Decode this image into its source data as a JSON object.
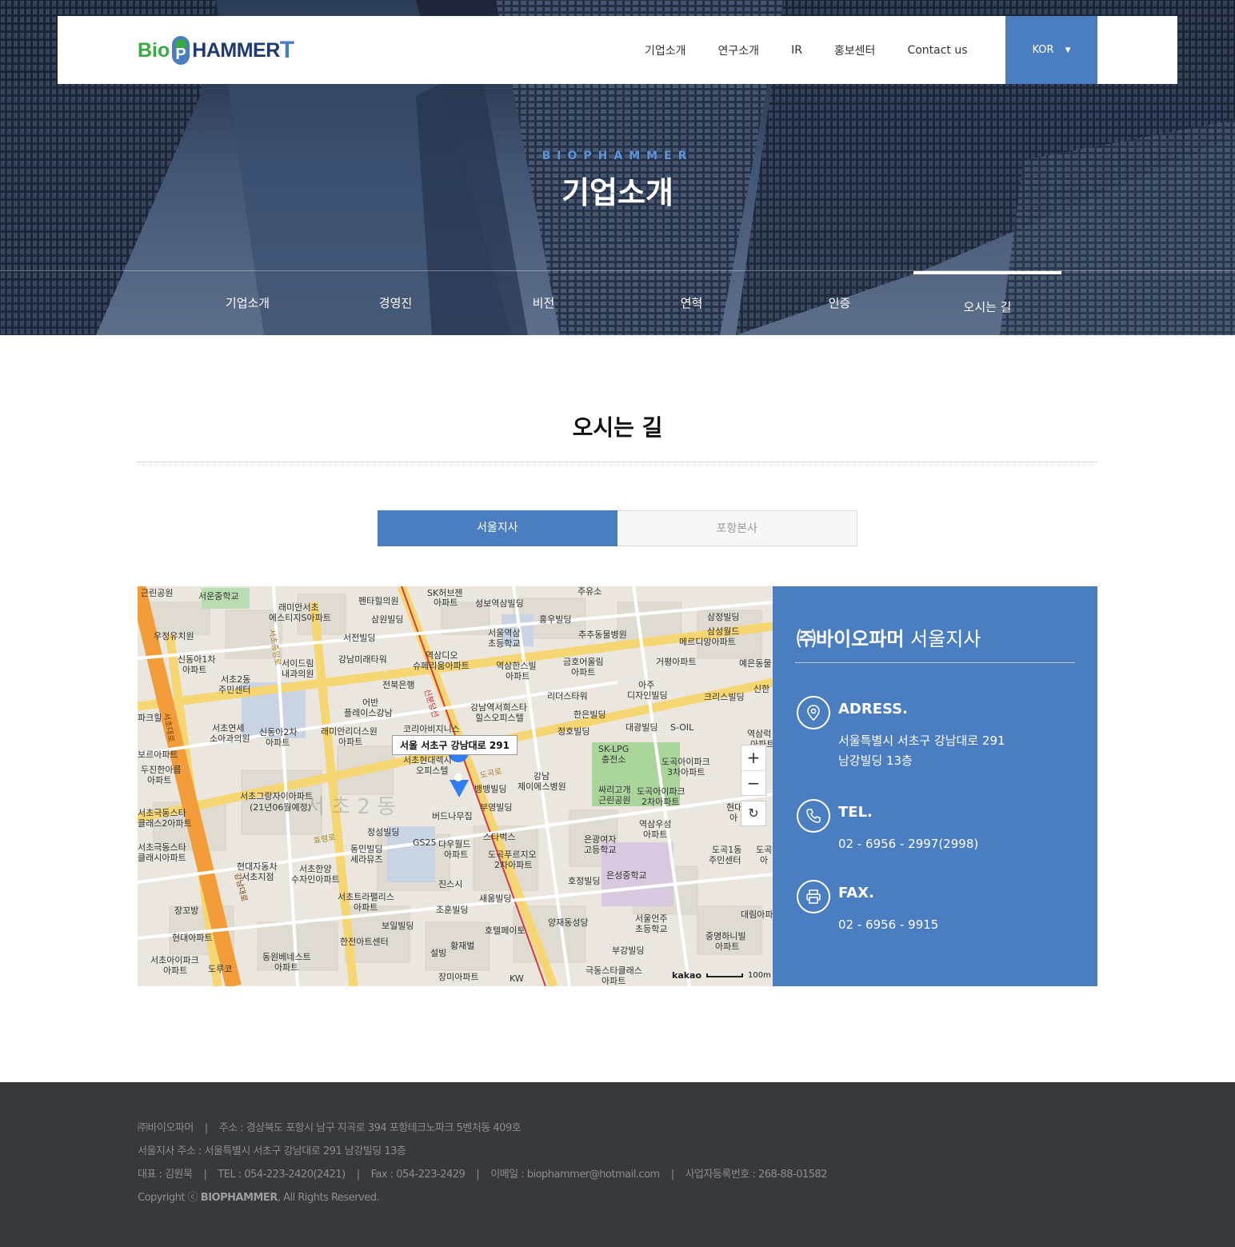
{
  "header": {
    "logo_bio": "Bio",
    "logo_p": "P",
    "logo_hammer": "HAMMER",
    "logo_t": "T",
    "nav": [
      "기업소개",
      "연구소개",
      "IR",
      "홍보센터",
      "Contact us"
    ],
    "lang": "KOR",
    "accent": "#4a7ec0"
  },
  "hero": {
    "eyebrow": "BIOPHAMMER",
    "title": "기업소개",
    "subnav": [
      "기업소개",
      "경영진",
      "비전",
      "연혁",
      "인증",
      "오시는 길"
    ],
    "active_subnav": "오시는 길"
  },
  "content": {
    "title": "오시는 길",
    "tabs": [
      "서울지사",
      "포항본사"
    ],
    "active_tab": "서울지사"
  },
  "map": {
    "callout": "서울 서초구 강남대로 291",
    "zoom_in": "+",
    "zoom_out": "−",
    "reset": "↻",
    "brand": "kakao",
    "scale": "100m",
    "labels": [
      "근린공원",
      "서운중학교",
      "래미안서초",
      "에스티지S아파트",
      "펜타힐의원",
      "SK허브젠",
      "아파트",
      "성보역삼빌딩",
      "주유소",
      "삼원빌딩",
      "홍우빌딩",
      "삼정빌딩",
      "우정유치원",
      "서전빌딩",
      "서울역삼",
      "초등학교",
      "추추동물병원",
      "삼성월드",
      "메르디앙아파트",
      "신동아1차",
      "아파트",
      "서이드림",
      "내과의원",
      "강남미래타워",
      "역삼디오",
      "슈페리움아파트",
      "역삼한스빌",
      "아파트",
      "금호어울림",
      "아파트",
      "거평아파트",
      "예은동물",
      "서초2동",
      "주민센터",
      "전북은행",
      "아주",
      "디자인빌딩",
      "크리스빌딩",
      "신한",
      "리더스타워",
      "어반",
      "플레이스강남",
      "강남역서희스타",
      "힐스오피스텔",
      "한은빌딩",
      "파크힐",
      "서초연세",
      "소아과의원",
      "신동아2차",
      "아파트",
      "래미안리더스원",
      "아파트",
      "코리아비지니스",
      "정호빌딩",
      "대광빌딩",
      "S-OIL",
      "역삼럭",
      "아파트",
      "서초현대렉시",
      "오피스텔",
      "SK-LPG",
      "충전소",
      "도곡아이파크",
      "3차아파트",
      "보르아파트",
      "두진한아름",
      "아파트",
      "강남",
      "제이에스병원",
      "뱅뱅빌딩",
      "싸리고개",
      "근린공원",
      "도곡아이파크",
      "2차아파트",
      "서초그랑자이아파트",
      "(21년06월예정)",
      "버드나무집",
      "부영빌딩",
      "현대",
      "아",
      "서초극동스타",
      "클래스2아파트",
      "정성빌딩",
      "스타벅스",
      "역삼우성",
      "아파트",
      "은광여자",
      "고등학교",
      "도곡1동",
      "주민센터",
      "도곡",
      "아",
      "서초극동스타",
      "클래시아파트",
      "동민빌딩",
      "세라뮤즈",
      "GS25",
      "다우월드",
      "아파트",
      "도곡푸르지오",
      "2차아파트",
      "현대자동차",
      "서초지점",
      "서초한양",
      "수자인아파트",
      "진스시",
      "호정빌딩",
      "은성중학교",
      "서초트라팰리스",
      "아파트",
      "새움빌딩",
      "장꼬방",
      "조훈빌딩",
      "양재동성당",
      "서울언주",
      "초등학교",
      "대림아파",
      "보일빌딩",
      "호텔페이토",
      "중명하니빌",
      "아파트",
      "현대아파트",
      "한전아트센터",
      "황재벌",
      "설빙",
      "부강빌딩",
      "서초아이파크",
      "아파트",
      "도루코",
      "동원베네스트",
      "아파트",
      "장미아파트",
      "KW",
      "극동스타클래스",
      "아파트",
      "서 초 2 동",
      "신분당선",
      "도곡로",
      "효령로",
      "서초대로",
      "서초중앙로",
      "강남대로"
    ]
  },
  "info": {
    "company": "㈜바이오파머",
    "branch": "서울지사",
    "address_label": "ADRESS.",
    "address_lines": [
      "서울특별시 서초구 강남대로 291",
      "남강빌딩 13층"
    ],
    "tel_label": "TEL.",
    "tel": "02 - 6956 - 2997(2998)",
    "fax_label": "FAX.",
    "fax": "02 - 6956 - 9915"
  },
  "footer": {
    "line1": [
      "㈜바이오파머",
      "주소 : 경상북도 포항시 남구 지곡로 394 포항테크노파크 5벤처동 409호"
    ],
    "line2": "서울지사 주소 : 서울특별시 서초구 강남대로 291 남강빌딩 13층",
    "line3": [
      "대표 : 김원묵",
      "TEL : 054-223-2420(2421)",
      "Fax : 054-223-2429",
      "이메일 : biophammer@hotmail.com",
      "사업자등록번호 : 268-88-01582"
    ],
    "copyright_prefix": "Copyright ⓒ",
    "copyright_brand": "BIOPHAMMER",
    "copyright_suffix": ", All Rights Reserved.",
    "separator": "|"
  }
}
